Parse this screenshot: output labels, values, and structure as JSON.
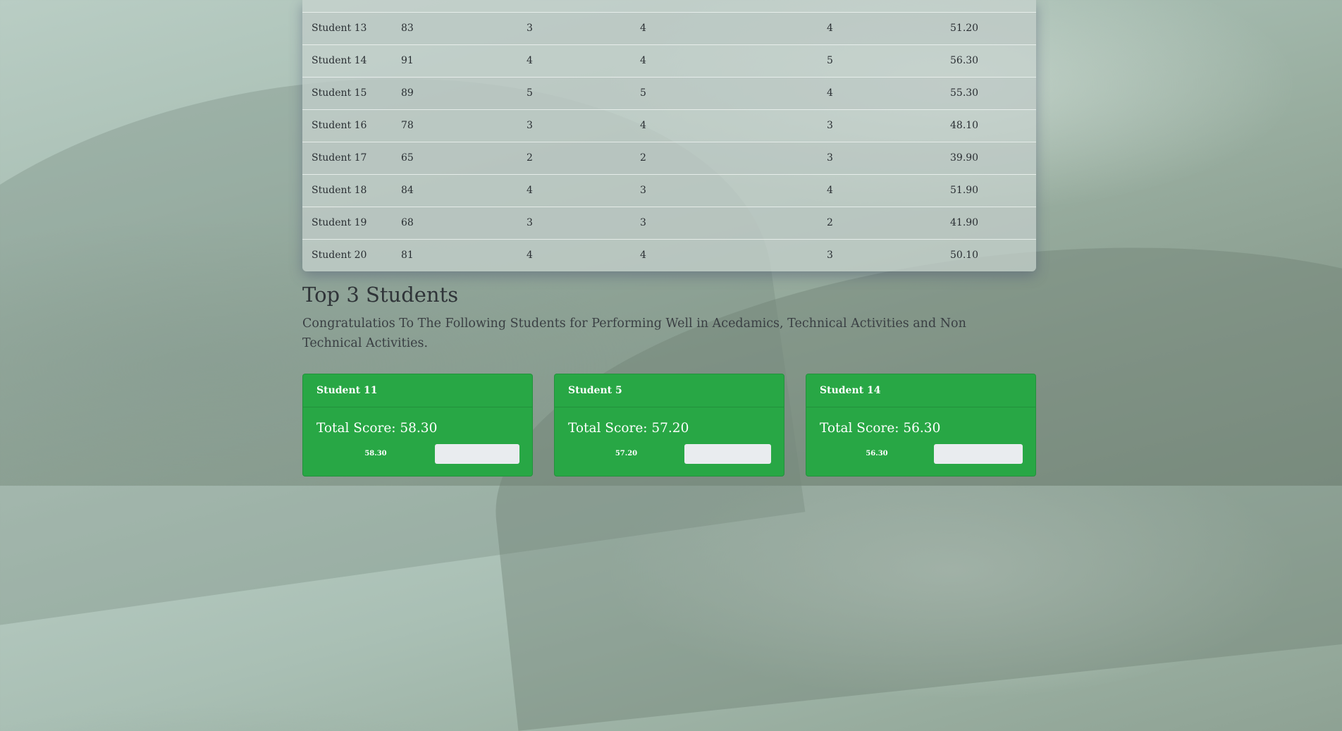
{
  "table": {
    "partial_row": {
      "name": "",
      "c1": "",
      "c2": "",
      "c3": "",
      "c4": "",
      "c5": ""
    },
    "rows": [
      {
        "name": "Student 13",
        "c1": "83",
        "c2": "3",
        "c3": "4",
        "c4": "4",
        "c5": "51.20"
      },
      {
        "name": "Student 14",
        "c1": "91",
        "c2": "4",
        "c3": "4",
        "c4": "5",
        "c5": "56.30"
      },
      {
        "name": "Student 15",
        "c1": "89",
        "c2": "5",
        "c3": "5",
        "c4": "4",
        "c5": "55.30"
      },
      {
        "name": "Student 16",
        "c1": "78",
        "c2": "3",
        "c3": "4",
        "c4": "3",
        "c5": "48.10"
      },
      {
        "name": "Student 17",
        "c1": "65",
        "c2": "2",
        "c3": "2",
        "c4": "3",
        "c5": "39.90"
      },
      {
        "name": "Student 18",
        "c1": "84",
        "c2": "4",
        "c3": "3",
        "c4": "4",
        "c5": "51.90"
      },
      {
        "name": "Student 19",
        "c1": "68",
        "c2": "3",
        "c3": "3",
        "c4": "2",
        "c5": "41.90"
      },
      {
        "name": "Student 20",
        "c1": "81",
        "c2": "4",
        "c3": "4",
        "c4": "3",
        "c5": "50.10"
      }
    ]
  },
  "top": {
    "title": "Top 3 Students",
    "subtitle": "Congratulatios To The Following Students for Performing Well in Acedamics, Technical Activities and Non Technical Activities.",
    "cards": [
      {
        "name": "Student 11",
        "score_text": "Total Score: 58.30",
        "bar_label": "58.30",
        "progress": 0.583
      },
      {
        "name": "Student 5",
        "score_text": "Total Score: 57.20",
        "bar_label": "57.20",
        "progress": 0.572
      },
      {
        "name": "Student 14",
        "score_text": "Total Score: 56.30",
        "bar_label": "56.30",
        "progress": 0.563
      }
    ]
  },
  "colors": {
    "card_bg": "#28a745",
    "bar_empty": "#e9ecef"
  }
}
